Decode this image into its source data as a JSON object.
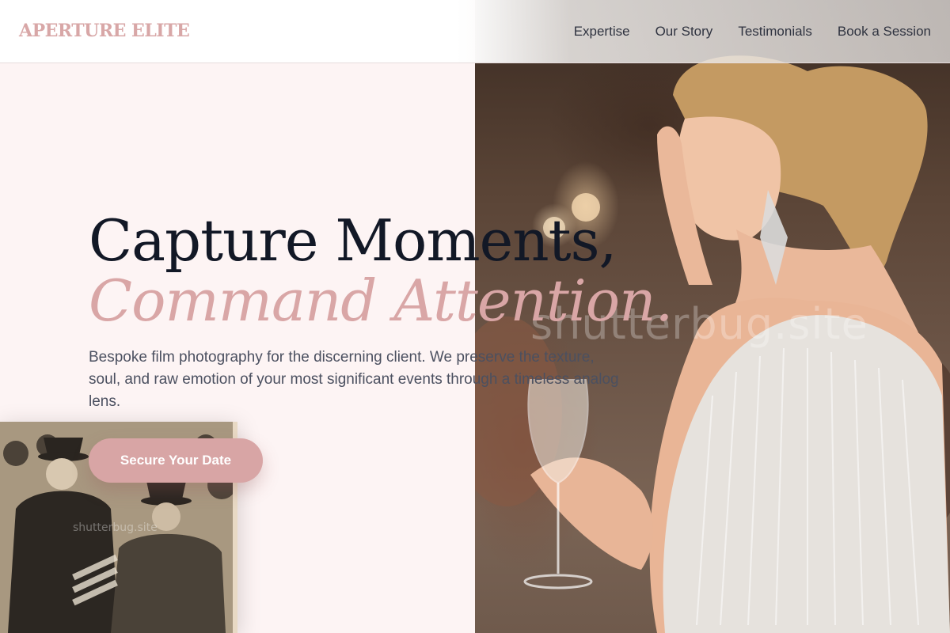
{
  "brand": {
    "logo_text": "APERTURE ELITE",
    "accent_color": "#d8a7a7"
  },
  "nav": {
    "items": [
      {
        "label": "Expertise"
      },
      {
        "label": "Our Story"
      },
      {
        "label": "Testimonials"
      },
      {
        "label": "Book a Session"
      }
    ]
  },
  "hero": {
    "headline": "Capture Moments,",
    "headline_accent": "Command Attention.",
    "subcopy": "Bespoke film photography for the discerning client. We preserve the texture, soul, and raw emotion of your most significant events through a timeless analog lens.",
    "cta_label": "Secure Your Date",
    "photo_watermark": "shutterbug.site",
    "vintage_watermark": "shutterbug.site"
  },
  "colors": {
    "page_background": "#fdf4f4",
    "headline": "#121826",
    "headline_accent": "#d9a6a6",
    "cta_background": "#d8a5a5"
  }
}
